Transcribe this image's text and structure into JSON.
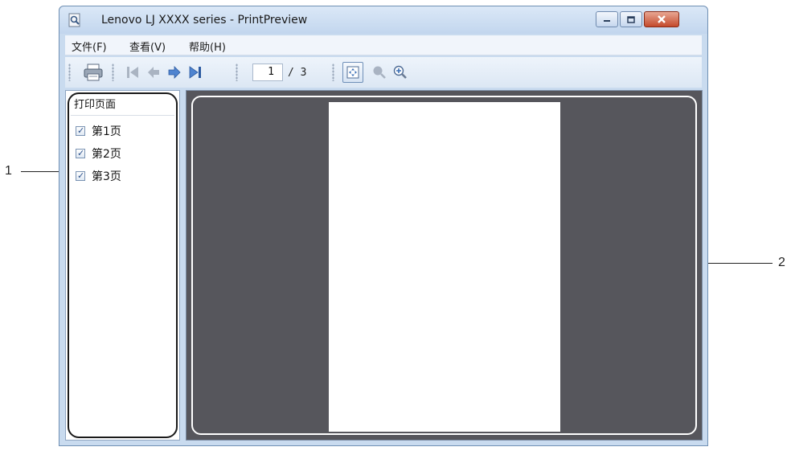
{
  "callouts": {
    "left_panel": "1",
    "preview": "2"
  },
  "window": {
    "title": "Lenovo LJ XXXX series - PrintPreview",
    "icons": [
      "app-icon",
      "minimize-icon",
      "maximize-icon",
      "close-icon"
    ]
  },
  "menu": {
    "file": "文件(F)",
    "view": "查看(V)",
    "help": "帮助(H)"
  },
  "toolbar": {
    "current_page": "1",
    "page_total": "/ 3",
    "icons": [
      "print-icon",
      "first-page-icon",
      "previous-page-icon",
      "next-page-icon",
      "last-page-icon",
      "fit-page-icon",
      "zoom-out-icon",
      "zoom-in-icon"
    ]
  },
  "print_pages": {
    "header": "打印页面",
    "items": [
      {
        "label": "第1页",
        "checked": true
      },
      {
        "label": "第2页",
        "checked": true
      },
      {
        "label": "第3页",
        "checked": true
      }
    ],
    "check_glyph": "✓"
  },
  "colors": {
    "preview_background": "#56565c",
    "window_frame": "#c9dbef",
    "close_button": "#c44a2c"
  }
}
